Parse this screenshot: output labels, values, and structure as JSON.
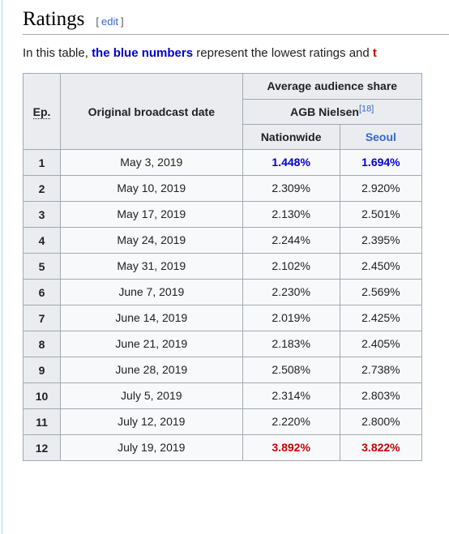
{
  "section": {
    "title": "Ratings",
    "edit_open_bracket": "[",
    "edit_label": "edit",
    "edit_close_bracket": "]"
  },
  "intro": {
    "part1": "In this table, ",
    "blue_text": "the blue numbers",
    "part2": " represent the lowest ratings and ",
    "red_text_truncated": "t"
  },
  "table": {
    "headers": {
      "episode": "Ep.",
      "broadcast_date": "Original broadcast date",
      "average_audience_share": "Average audience share",
      "provider": "AGB Nielsen",
      "provider_ref": "[18]",
      "nationwide": "Nationwide",
      "seoul": "Seoul"
    },
    "rows": [
      {
        "ep": "1",
        "date": "May 3, 2019",
        "nationwide": "1.448%",
        "seoul": "1.694%",
        "style": "low"
      },
      {
        "ep": "2",
        "date": "May 10, 2019",
        "nationwide": "2.309%",
        "seoul": "2.920%",
        "style": "normal"
      },
      {
        "ep": "3",
        "date": "May 17, 2019",
        "nationwide": "2.130%",
        "seoul": "2.501%",
        "style": "normal"
      },
      {
        "ep": "4",
        "date": "May 24, 2019",
        "nationwide": "2.244%",
        "seoul": "2.395%",
        "style": "normal"
      },
      {
        "ep": "5",
        "date": "May 31, 2019",
        "nationwide": "2.102%",
        "seoul": "2.450%",
        "style": "normal"
      },
      {
        "ep": "6",
        "date": "June 7, 2019",
        "nationwide": "2.230%",
        "seoul": "2.569%",
        "style": "normal"
      },
      {
        "ep": "7",
        "date": "June 14, 2019",
        "nationwide": "2.019%",
        "seoul": "2.425%",
        "style": "normal"
      },
      {
        "ep": "8",
        "date": "June 21, 2019",
        "nationwide": "2.183%",
        "seoul": "2.405%",
        "style": "normal"
      },
      {
        "ep": "9",
        "date": "June 28, 2019",
        "nationwide": "2.508%",
        "seoul": "2.738%",
        "style": "normal"
      },
      {
        "ep": "10",
        "date": "July 5, 2019",
        "nationwide": "2.314%",
        "seoul": "2.803%",
        "style": "normal"
      },
      {
        "ep": "11",
        "date": "July 12, 2019",
        "nationwide": "2.220%",
        "seoul": "2.800%",
        "style": "normal"
      },
      {
        "ep": "12",
        "date": "July 19, 2019",
        "nationwide": "3.892%",
        "seoul": "3.822%",
        "style": "high"
      }
    ]
  },
  "colors": {
    "low_value": "#0000cc",
    "high_value": "#cc0000",
    "link": "#3366cc",
    "table_border": "#a2a9b1",
    "header_bg": "#eaecf0",
    "cell_bg": "#f8f9fa"
  }
}
